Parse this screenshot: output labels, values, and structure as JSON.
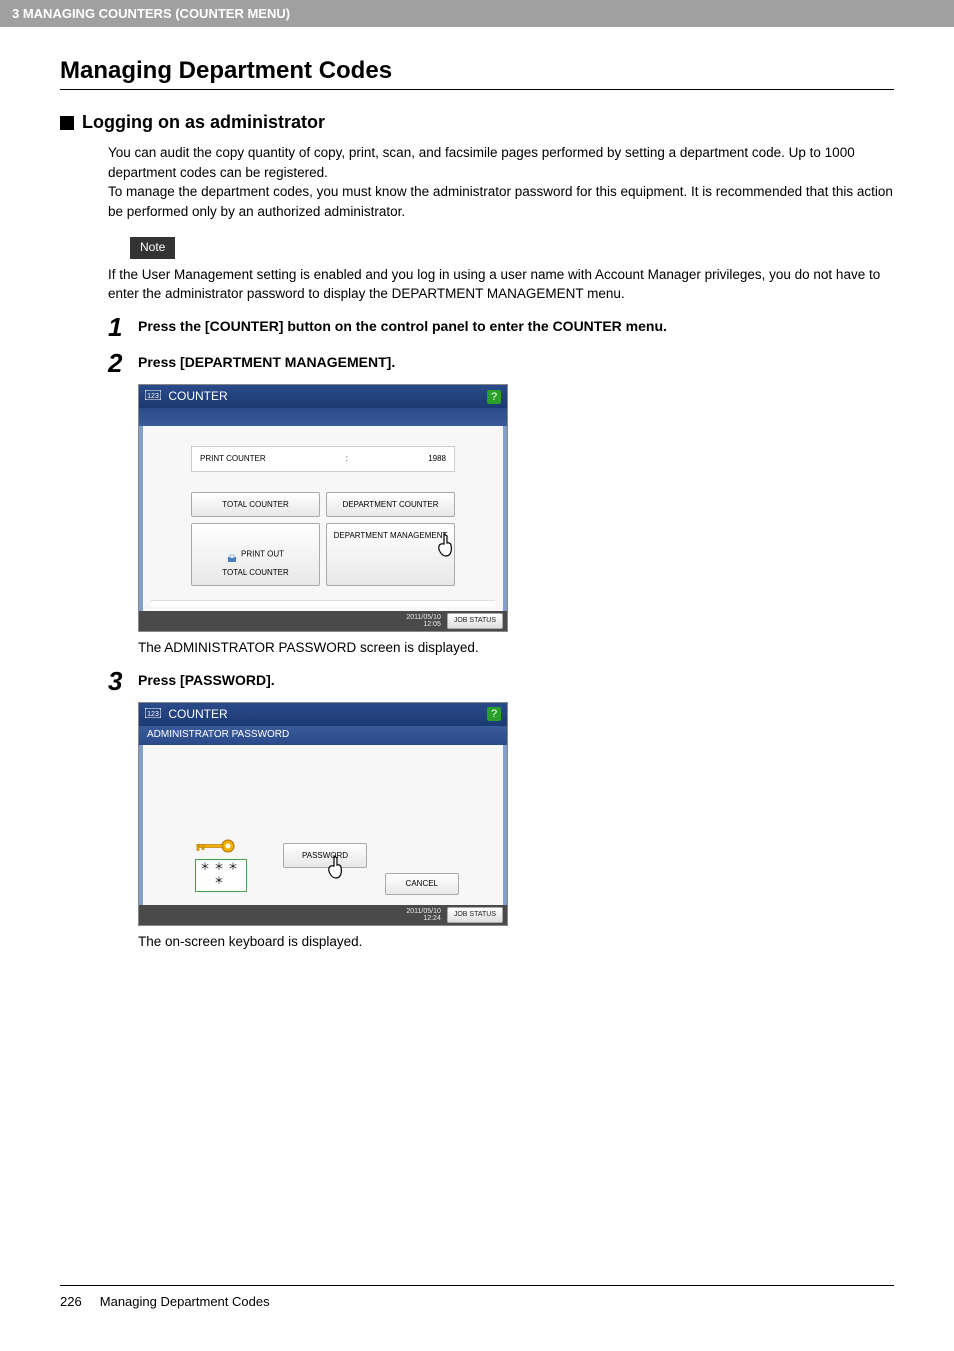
{
  "header": "3 MANAGING COUNTERS (COUNTER MENU)",
  "title": "Managing Department Codes",
  "section": "Logging on as administrator",
  "intro1": "You can audit the copy quantity of copy, print, scan, and facsimile pages performed by setting a department code. Up to 1000 department codes can be registered.",
  "intro2": "To manage the department codes, you must know the administrator password for this equipment. It is recommended that this action be performed only by an authorized administrator.",
  "noteLabel": "Note",
  "noteText": "If the User Management setting is enabled and you log in using a user name with Account Manager privileges, you do not have to enter the administrator password to display the DEPARTMENT MANAGEMENT menu.",
  "steps": {
    "s1": {
      "num": "1",
      "text": "Press the [COUNTER] button on the control panel to enter the COUNTER menu."
    },
    "s2": {
      "num": "2",
      "text": "Press [DEPARTMENT MANAGEMENT].",
      "after": "The ADMINISTRATOR PASSWORD screen is displayed."
    },
    "s3": {
      "num": "3",
      "text": "Press [PASSWORD].",
      "after": "The on-screen keyboard is displayed."
    }
  },
  "screen1": {
    "title": "COUNTER",
    "printCounterLabel": "PRINT COUNTER",
    "printCounterSep": ":",
    "printCounterVal": "1988",
    "btn1": "TOTAL COUNTER",
    "btn2": "DEPARTMENT COUNTER",
    "btn3": "PRINT OUT\nTOTAL COUNTER",
    "btn4": "DEPARTMENT MANAGEMENT",
    "date": "2011/05/10",
    "time": "12:05",
    "jobStatus": "JOB STATUS"
  },
  "screen2": {
    "title": "COUNTER",
    "subtitle": "ADMINISTRATOR PASSWORD",
    "masked": "＊＊＊＊",
    "pwBtn": "PASSWORD",
    "cancel": "CANCEL",
    "date": "2011/05/10",
    "time": "12:24",
    "jobStatus": "JOB STATUS"
  },
  "footer": {
    "pageNum": "226",
    "text": "Managing Department Codes"
  }
}
